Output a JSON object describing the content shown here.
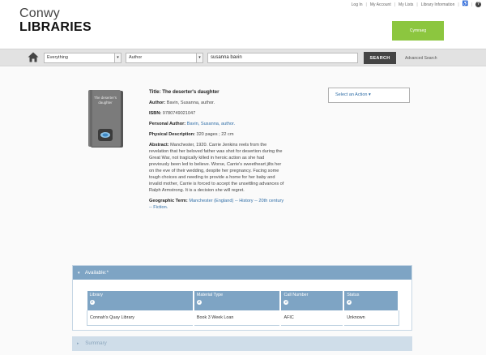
{
  "brand": {
    "line1": "Conwy",
    "line2": "LIBRARIES"
  },
  "toplinks": {
    "login": "Log In",
    "account": "My Account",
    "lists": "My Lists",
    "info": "Library Information",
    "accessibility_icon": "accessibility-icon",
    "help_icon": "help-icon"
  },
  "cymraeg": "Cymraeg",
  "search": {
    "scope": "Everything",
    "field": "Author",
    "query": "susanna bavin",
    "button": "SEARCH",
    "advanced": "Advanced Search"
  },
  "record": {
    "title_label": "Title:",
    "title": "The deserter's daughter",
    "author_label": "Author:",
    "author": "Bavin, Susanna, author.",
    "isbn_label": "ISBN:",
    "isbn": "9780749021047",
    "personal_author_label": "Personal Author:",
    "personal_author": "Bavin, Susanna, author.",
    "physical_label": "Physical Description:",
    "physical": "320 pages ; 22 cm",
    "abstract_label": "Abstract:",
    "abstract": "Manchester, 1920. Carrie Jenkins reels from the revelation that her beloved father was shot for desertion during the Great War, not tragically killed in heroic action as she had previously been led to believe. Worse, Carrie's sweetheart jilts her on the eve of their wedding, despite her pregnancy. Facing some tough choices and needing to provide a home for her baby and invalid mother, Carrie is forced to accept the unsettling advances of Ralph Armstrong. It is a decision she will regret.",
    "geo_label": "Geographic Term:",
    "geo": "Manchester (England) -- History -- 20th century -- Fiction.",
    "cover_title": "The deserter's daughter",
    "action_button": "Select an Action"
  },
  "availability": {
    "heading": "Available:*",
    "columns": [
      "Library",
      "Material Type",
      "Call Number",
      "Status"
    ],
    "rows": [
      [
        "Connah's Quay Library",
        "Book 3 Week Loan",
        "AFIC",
        "Unknown"
      ]
    ]
  },
  "summary": "Summary",
  "colors": {
    "green": "#8cc63f",
    "panel_blue": "#7ea4c4",
    "link_blue": "#2f6da6",
    "dark_button": "#444444"
  }
}
